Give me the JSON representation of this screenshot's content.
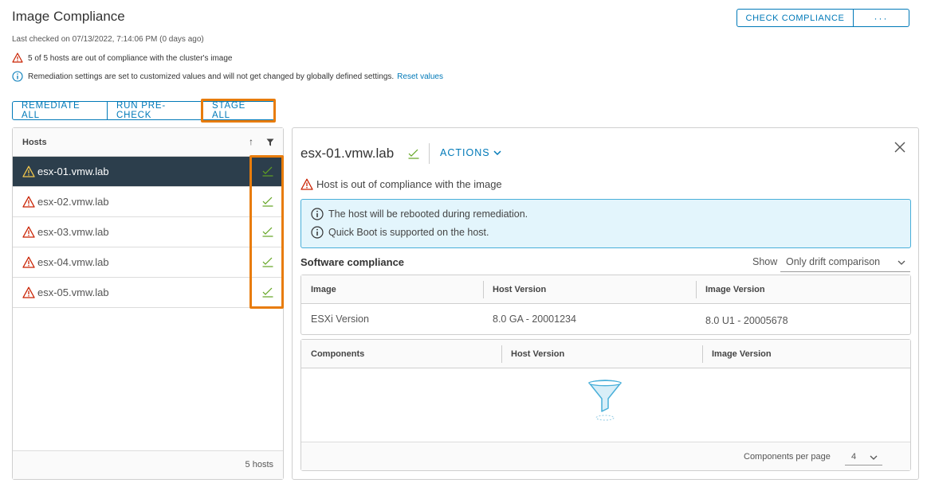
{
  "header": {
    "title": "Image Compliance",
    "last_checked": "Last checked on 07/13/2022, 7:14:06 PM (0 days ago)",
    "warning_text": "5 of 5 hosts are out of compliance with the cluster's image",
    "info_text": "Remediation settings are set to customized values and will not get changed by globally defined settings.",
    "reset_link": "Reset values",
    "check_compliance": "CHECK COMPLIANCE",
    "more": "···"
  },
  "actions": {
    "remediate_all": "REMEDIATE ALL",
    "run_precheck": "RUN PRE-CHECK",
    "stage_all": "STAGE ALL"
  },
  "hosts": {
    "column": "Hosts",
    "sort_glyph": "↑",
    "items": [
      {
        "name": "esx-01.vmw.lab",
        "selected": true
      },
      {
        "name": "esx-02.vmw.lab",
        "selected": false
      },
      {
        "name": "esx-03.vmw.lab",
        "selected": false
      },
      {
        "name": "esx-04.vmw.lab",
        "selected": false
      },
      {
        "name": "esx-05.vmw.lab",
        "selected": false
      }
    ],
    "footer": "5 hosts"
  },
  "detail": {
    "host": "esx-01.vmw.lab",
    "actions": "ACTIONS",
    "status": "Host is out of compliance with the image",
    "info1": "The host will be rebooted during remediation.",
    "info2": "Quick Boot is supported on the host.",
    "section_title": "Software compliance",
    "show_label": "Show",
    "show_value": "Only drift comparison",
    "image_table": {
      "headers": [
        "Image",
        "Host Version",
        "Image Version"
      ],
      "row": [
        "ESXi Version",
        "8.0 GA - 20001234",
        "8.0 U1 - 20005678"
      ]
    },
    "components_table": {
      "headers": [
        "Components",
        "Host Version",
        "Image Version"
      ],
      "per_page_label": "Components per page",
      "per_page": "4"
    }
  },
  "colors": {
    "accent": "#0079b8",
    "highlight": "#e87c0c",
    "selected_row": "#2c3e4c",
    "warning": "#c92100",
    "check": "#62a420",
    "info_bg": "#e3f5fc"
  }
}
